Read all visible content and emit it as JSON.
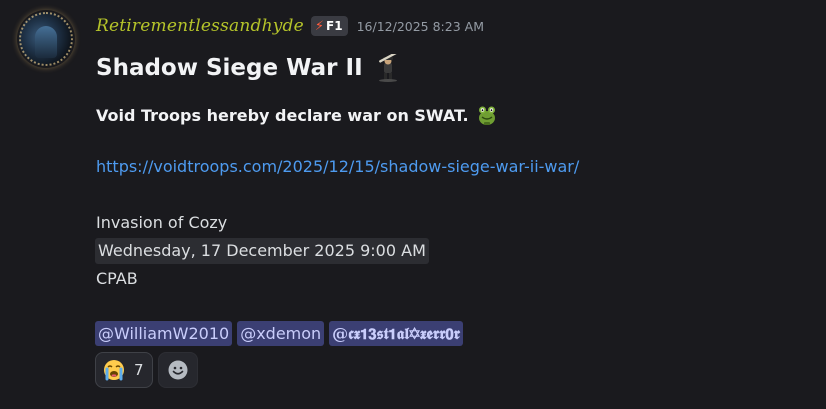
{
  "message": {
    "author": {
      "username": "Retirementlessandhyde",
      "tag_icon": "lightning-bolt-icon",
      "tag_label": "F1",
      "avatar_icon": "avatar-image"
    },
    "timestamp": "16/12/2025 8:23 AM",
    "title": "Shadow Siege War II",
    "title_emoji": "soldier-emoji-icon",
    "subtitle": "Void Troops hereby declare war on SWAT.",
    "subtitle_emoji": "frog-emoji-icon",
    "link": "https://voidtroops.com/2025/12/15/shadow-siege-war-ii-war/",
    "event_name": "Invasion of Cozy",
    "event_time": "Wednesday, 17 December 2025 9:00 AM",
    "event_location": "CPAB",
    "mentions": [
      "@WilliamW2010",
      "@xdemon",
      "@𝖈𝖝𝟭𝟯𝖘𝖙𝟭𝖆𝖑✡𝖝𝖊𝖗𝖗𝟬𝖗"
    ],
    "reactions": [
      {
        "emoji": "loudly-crying-face-emoji-icon",
        "count": "7"
      }
    ],
    "add_reaction_icon": "add-reaction-smiley-icon"
  },
  "colors": {
    "background": "#1a1a1e",
    "username": "#b5c42a",
    "link": "#4e9bf0",
    "mention_bg": "#3b3f73",
    "mention_text": "#c9cdfb",
    "timestamp": "#949ba4"
  }
}
